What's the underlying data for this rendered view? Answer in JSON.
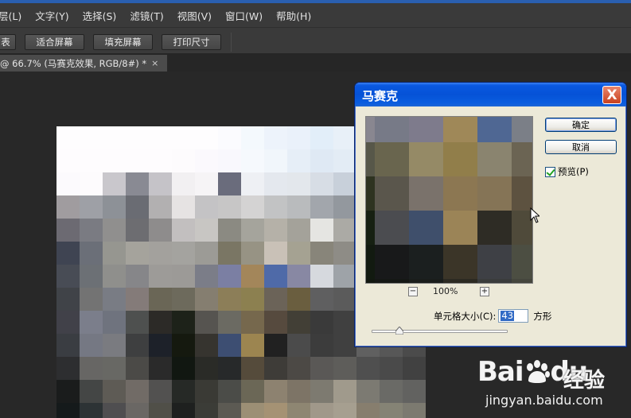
{
  "menu": [
    "层(L)",
    "文字(Y)",
    "选择(S)",
    "滤镜(T)",
    "视图(V)",
    "窗口(W)",
    "帮助(H)"
  ],
  "options_bar": {
    "partial_button": "表",
    "fit_screen": "适合屏幕",
    "fill_screen": "填充屏幕",
    "print_size": "打印尺寸"
  },
  "document_tab": {
    "title": "@ 66.7% (马赛克效果, RGB/8#) *",
    "close": "×"
  },
  "dialog": {
    "title": "马赛克",
    "close_glyph": "X",
    "ok": "确定",
    "cancel": "取消",
    "preview_label": "预览(P)",
    "preview_checked": true,
    "zoom_out": "−",
    "zoom_in": "+",
    "zoom_level": "100%",
    "cell_size_label": "单元格大小(C):",
    "cell_size_value": "43",
    "cell_size_unit": "方形"
  },
  "watermark": {
    "logo": "Bai",
    "logo_suffix": "du",
    "text": "经验",
    "url": "jingyan.baidu.com"
  },
  "colors": {
    "accent": "#0552d7",
    "workspace": "#282828",
    "panel": "#3a3a3a",
    "dialog_bg": "#ece9d8"
  }
}
